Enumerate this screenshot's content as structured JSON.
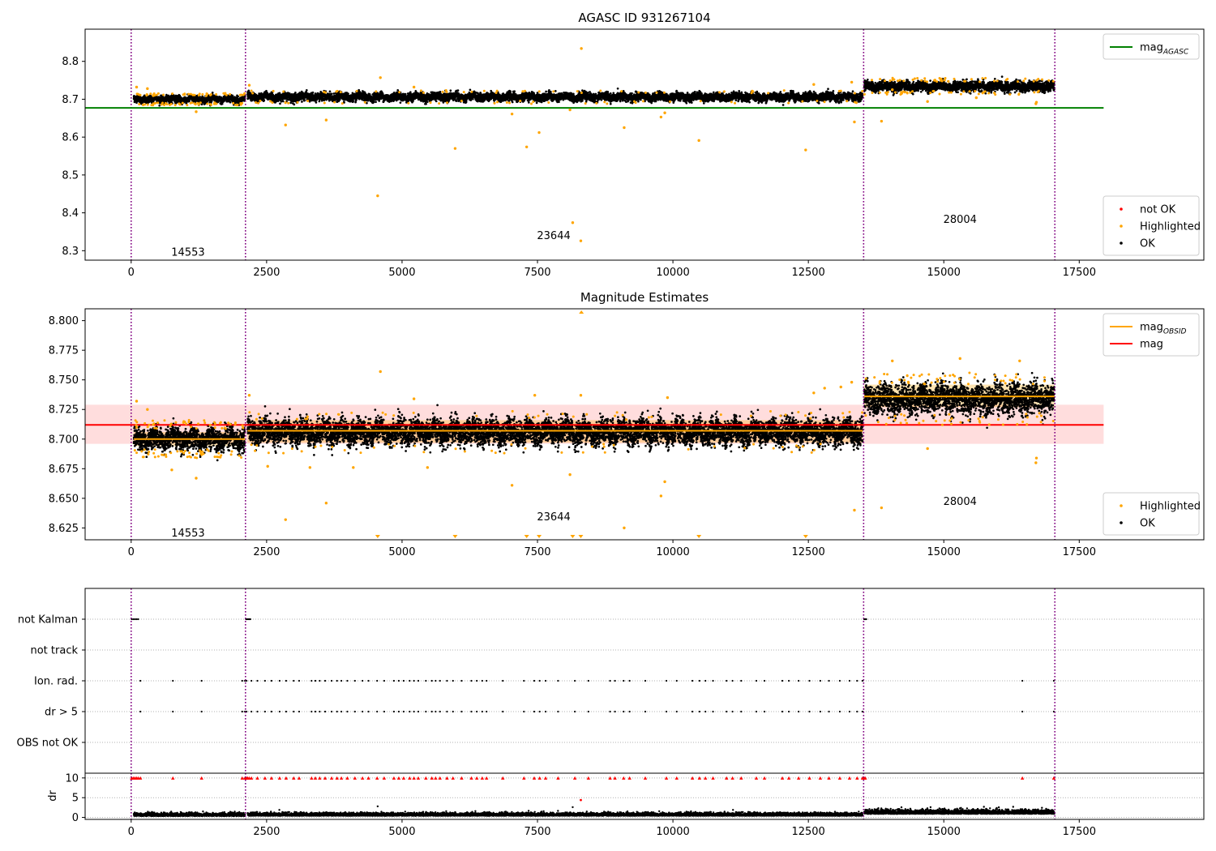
{
  "chart_data": [
    {
      "type": "scatter",
      "title": "AGASC ID 931267104",
      "xlim": [
        -850,
        19800
      ],
      "ylim": [
        8.275,
        8.885
      ],
      "x_ticks": [
        0,
        2500,
        5000,
        7500,
        10000,
        12500,
        15000,
        17500
      ],
      "y_ticks": [
        8.3,
        8.4,
        8.5,
        8.6,
        8.7,
        8.8
      ],
      "y_tick_labels": [
        "8.3",
        "8.4",
        "8.5",
        "8.6",
        "8.7",
        "8.8"
      ],
      "obsid_boundaries": [
        0,
        2110,
        13520,
        17050
      ],
      "obsid_labels": [
        {
          "text": "14553",
          "x": 1050,
          "y": 8.298
        },
        {
          "text": "23644",
          "x": 7800,
          "y": 8.341
        },
        {
          "text": "28004",
          "x": 15300,
          "y": 8.384
        }
      ],
      "series": [
        {
          "name": "OK",
          "color": "#000000",
          "segments": [
            {
              "x0": 50,
              "x1": 2100,
              "level": 8.7,
              "spread": 0.008
            },
            {
              "x0": 2150,
              "x1": 13500,
              "level": 8.706,
              "spread": 0.009
            },
            {
              "x0": 13530,
              "x1": 17040,
              "level": 8.734,
              "spread": 0.011
            }
          ]
        },
        {
          "name": "Highlighted",
          "color": "#ffa500",
          "points": [
            [
              4550,
              8.445
            ],
            [
              5980,
              8.57
            ],
            [
              7300,
              8.574
            ],
            [
              7530,
              8.612
            ],
            [
              8150,
              8.374
            ],
            [
              8300,
              8.326
            ],
            [
              8310,
              8.834
            ],
            [
              9100,
              8.625
            ],
            [
              9780,
              8.653
            ],
            [
              9850,
              8.664
            ],
            [
              10480,
              8.591
            ],
            [
              12450,
              8.566
            ],
            [
              13350,
              8.64
            ],
            [
              13850,
              8.642
            ],
            [
              2850,
              8.632
            ],
            [
              3600,
              8.645
            ],
            [
              4600,
              8.757
            ],
            [
              7030,
              8.661
            ],
            [
              8100,
              8.672
            ],
            [
              1200,
              8.667
            ],
            [
              100,
              8.732
            ],
            [
              300,
              8.728
            ],
            [
              5220,
              8.732
            ],
            [
              14700,
              8.694
            ],
            [
              16710,
              8.692
            ],
            [
              16700,
              8.688
            ],
            [
              2180,
              8.737
            ],
            [
              12600,
              8.739
            ],
            [
              13300,
              8.745
            ],
            [
              14050,
              8.725
            ],
            [
              15600,
              8.704
            ]
          ]
        },
        {
          "name": "not OK",
          "color": "#ff0000",
          "points": []
        }
      ],
      "reference_lines": [
        {
          "name": "mag",
          "sub": "AGASC",
          "value": 8.677,
          "x0": -850,
          "x1": 17950,
          "color": "#008000"
        }
      ],
      "legends": [
        {
          "position": "upper right",
          "entries": [
            {
              "text": "mag",
              "sub": "AGASC",
              "kind": "line",
              "color": "#008000"
            }
          ]
        },
        {
          "position": "lower right",
          "entries": [
            {
              "text": "not OK",
              "kind": "dot",
              "color": "#ff0000"
            },
            {
              "text": "Highlighted",
              "kind": "dot",
              "color": "#ffa500"
            },
            {
              "text": "OK",
              "kind": "dot",
              "color": "#000000"
            }
          ]
        }
      ]
    },
    {
      "type": "scatter",
      "title": "Magnitude Estimates",
      "xlim": [
        -850,
        19800
      ],
      "ylim": [
        8.615,
        8.81
      ],
      "x_ticks": [
        0,
        2500,
        5000,
        7500,
        10000,
        12500,
        15000,
        17500
      ],
      "y_ticks": [
        8.625,
        8.65,
        8.675,
        8.7,
        8.725,
        8.75,
        8.775,
        8.8
      ],
      "y_tick_labels": [
        "8.625",
        "8.650",
        "8.675",
        "8.700",
        "8.725",
        "8.750",
        "8.775",
        "8.800"
      ],
      "obsid_boundaries": [
        0,
        2110,
        13520,
        17050
      ],
      "obsid_labels": [
        {
          "text": "14553",
          "x": 1050,
          "y": 8.621
        },
        {
          "text": "23644",
          "x": 7800,
          "y": 8.635
        },
        {
          "text": "28004",
          "x": 15300,
          "y": 8.648
        }
      ],
      "band": {
        "y0": 8.696,
        "y1": 8.729,
        "x0": -850,
        "x1": 17950,
        "color": "#ffdddd"
      },
      "obsid_bands": [
        {
          "x0": 50,
          "x1": 2100,
          "y0": 8.694,
          "y1": 8.706
        },
        {
          "x0": 2150,
          "x1": 13500,
          "y0": 8.697,
          "y1": 8.716
        },
        {
          "x0": 13530,
          "x1": 17040,
          "y0": 8.727,
          "y1": 8.746
        }
      ],
      "series": [
        {
          "name": "OK",
          "color": "#000000",
          "segments": [
            {
              "x0": 50,
              "x1": 2100,
              "level": 8.7,
              "spread": 0.008
            },
            {
              "x0": 2150,
              "x1": 13500,
              "level": 8.706,
              "spread": 0.009
            },
            {
              "x0": 13530,
              "x1": 17040,
              "level": 8.734,
              "spread": 0.011
            }
          ]
        },
        {
          "name": "Highlighted",
          "color": "#ffa500",
          "points": [
            [
              2850,
              8.632
            ],
            [
              3600,
              8.646
            ],
            [
              4600,
              8.757
            ],
            [
              7030,
              8.661
            ],
            [
              8100,
              8.67
            ],
            [
              1200,
              8.667
            ],
            [
              9100,
              8.625
            ],
            [
              9780,
              8.652
            ],
            [
              9850,
              8.664
            ],
            [
              13350,
              8.64
            ],
            [
              13850,
              8.642
            ],
            [
              14700,
              8.692
            ],
            [
              16700,
              8.68
            ],
            [
              16710,
              8.684
            ],
            [
              100,
              8.732
            ],
            [
              300,
              8.725
            ],
            [
              5220,
              8.734
            ],
            [
              2180,
              8.737
            ],
            [
              12600,
              8.739
            ],
            [
              13300,
              8.748
            ],
            [
              14050,
              8.766
            ],
            [
              15300,
              8.768
            ],
            [
              16400,
              8.766
            ],
            [
              750,
              8.674
            ],
            [
              2520,
              8.677
            ],
            [
              3300,
              8.676
            ],
            [
              4100,
              8.676
            ],
            [
              5470,
              8.676
            ],
            [
              7450,
              8.737
            ],
            [
              8300,
              8.737
            ],
            [
              9900,
              8.735
            ],
            [
              12800,
              8.743
            ],
            [
              13100,
              8.744
            ]
          ]
        },
        {
          "name": "Highlighted (out of range)",
          "color": "#ffa500",
          "markers": "triangle",
          "points_low": [
            4550,
            5980,
            7300,
            7530,
            8150,
            8300,
            10480,
            12450
          ],
          "points_high": [
            8310
          ]
        }
      ],
      "reference_lines": [
        {
          "name": "mag",
          "value": 8.712,
          "x0": -850,
          "x1": 17950,
          "color": "#ff0000"
        },
        {
          "name": "mag",
          "sub": "OBSID",
          "values": [
            {
              "x0": 50,
              "x1": 2100,
              "value": 8.7
            },
            {
              "x0": 2150,
              "x1": 13500,
              "value": 8.707
            },
            {
              "x0": 13530,
              "x1": 17040,
              "value": 8.736
            }
          ],
          "color": "#ffa500"
        }
      ],
      "legends": [
        {
          "position": "upper right",
          "entries": [
            {
              "text": "mag",
              "sub": "OBSID",
              "kind": "line",
              "color": "#ffa500"
            },
            {
              "text": "mag",
              "kind": "line",
              "color": "#ff0000"
            }
          ]
        },
        {
          "position": "lower right",
          "entries": [
            {
              "text": "Highlighted",
              "kind": "dot",
              "color": "#ffa500"
            },
            {
              "text": "OK",
              "kind": "dot",
              "color": "#000000"
            }
          ]
        }
      ]
    },
    {
      "type": "scatter",
      "title": "",
      "xlim": [
        -850,
        19800
      ],
      "categories": [
        "not Kalman",
        "not track",
        "Ion. rad.",
        "dr > 5",
        "OBS not OK"
      ],
      "obsid_boundaries": [
        0,
        2110,
        13520,
        17050
      ],
      "flag_points": {
        "not Kalman": [
          10,
          40,
          70,
          100,
          130,
          2120,
          2140,
          2160,
          2180,
          2200,
          13530,
          13550,
          13570
        ],
        "not track": [],
        "Ion. rad.": [
          170,
          770,
          1300,
          2050,
          2100,
          2130,
          2220,
          2330,
          2470,
          2590,
          2740,
          2860,
          3000,
          3100,
          3330,
          3400,
          3480,
          3580,
          3700,
          3800,
          3880,
          3990,
          4130,
          4270,
          4380,
          4540,
          4670,
          4850,
          4940,
          5030,
          5140,
          5220,
          5300,
          5440,
          5550,
          5620,
          5700,
          5830,
          5940,
          6100,
          6280,
          6380,
          6480,
          6560,
          6860,
          7250,
          7440,
          7540,
          7650,
          7880,
          8190,
          8440,
          8840,
          8930,
          9090,
          9200,
          9490,
          9880,
          10070,
          10360,
          10490,
          10600,
          10740,
          10990,
          11100,
          11260,
          11540,
          11690,
          12020,
          12140,
          12320,
          12520,
          12720,
          12880,
          13080,
          13260,
          13400,
          13500,
          16450,
          17030
        ],
        "dr > 5": [
          170,
          770,
          1300,
          2050,
          2100,
          2130,
          2220,
          2330,
          2470,
          2590,
          2740,
          2860,
          3000,
          3100,
          3330,
          3400,
          3480,
          3580,
          3700,
          3800,
          3880,
          3990,
          4130,
          4270,
          4380,
          4540,
          4670,
          4850,
          4940,
          5030,
          5140,
          5220,
          5300,
          5440,
          5550,
          5620,
          5700,
          5830,
          5940,
          6100,
          6280,
          6380,
          6480,
          6560,
          6860,
          7250,
          7440,
          7540,
          7650,
          7880,
          8190,
          8440,
          8840,
          8930,
          9090,
          9200,
          9490,
          9880,
          10070,
          10360,
          10490,
          10600,
          10740,
          10990,
          11100,
          11260,
          11540,
          11690,
          12020,
          12140,
          12320,
          12520,
          12720,
          12880,
          13080,
          13260,
          13400,
          13500,
          16450,
          17030
        ],
        "OBS not OK": []
      }
    },
    {
      "type": "scatter",
      "ylabel": "dr",
      "xlim": [
        -850,
        19800
      ],
      "ylim": [
        -0.5,
        11.2
      ],
      "x_ticks": [
        0,
        2500,
        5000,
        7500,
        10000,
        12500,
        15000,
        17500
      ],
      "y_ticks": [
        0,
        5,
        10
      ],
      "y_tick_labels": [
        "0",
        "5",
        "10"
      ],
      "obsid_boundaries": [
        0,
        2110,
        13520,
        17050
      ],
      "series": [
        {
          "name": "OK",
          "color": "#000000",
          "segments": [
            {
              "x0": 50,
              "x1": 2100,
              "level": 0.5,
              "spread": 0.35
            },
            {
              "x0": 2150,
              "x1": 13500,
              "level": 0.55,
              "spread": 0.35
            },
            {
              "x0": 13530,
              "x1": 17040,
              "level": 1.1,
              "spread": 0.5
            }
          ],
          "points": [
            [
              4550,
              2.8
            ],
            [
              8150,
              2.6
            ]
          ]
        },
        {
          "name": "not OK",
          "color": "#ff0000",
          "points": [
            [
              8300,
              4.4
            ]
          ],
          "capped_at": 10,
          "capped_x": [
            10,
            40,
            70,
            100,
            130,
            170,
            770,
            1300,
            2050,
            2100,
            2130,
            2150,
            2180,
            2220,
            2330,
            2470,
            2590,
            2740,
            2860,
            3000,
            3100,
            3330,
            3400,
            3480,
            3580,
            3700,
            3800,
            3880,
            3990,
            4130,
            4270,
            4380,
            4540,
            4670,
            4850,
            4940,
            5030,
            5140,
            5220,
            5300,
            5440,
            5550,
            5620,
            5700,
            5830,
            5940,
            6100,
            6280,
            6380,
            6480,
            6560,
            6860,
            7250,
            7440,
            7540,
            7650,
            7880,
            8190,
            8440,
            8840,
            8930,
            9090,
            9200,
            9490,
            9880,
            10070,
            10360,
            10490,
            10600,
            10740,
            10990,
            11100,
            11260,
            11540,
            11690,
            12020,
            12140,
            12320,
            12520,
            12720,
            12880,
            13080,
            13260,
            13400,
            13500,
            13530,
            13550,
            16450,
            17030
          ]
        }
      ]
    }
  ]
}
